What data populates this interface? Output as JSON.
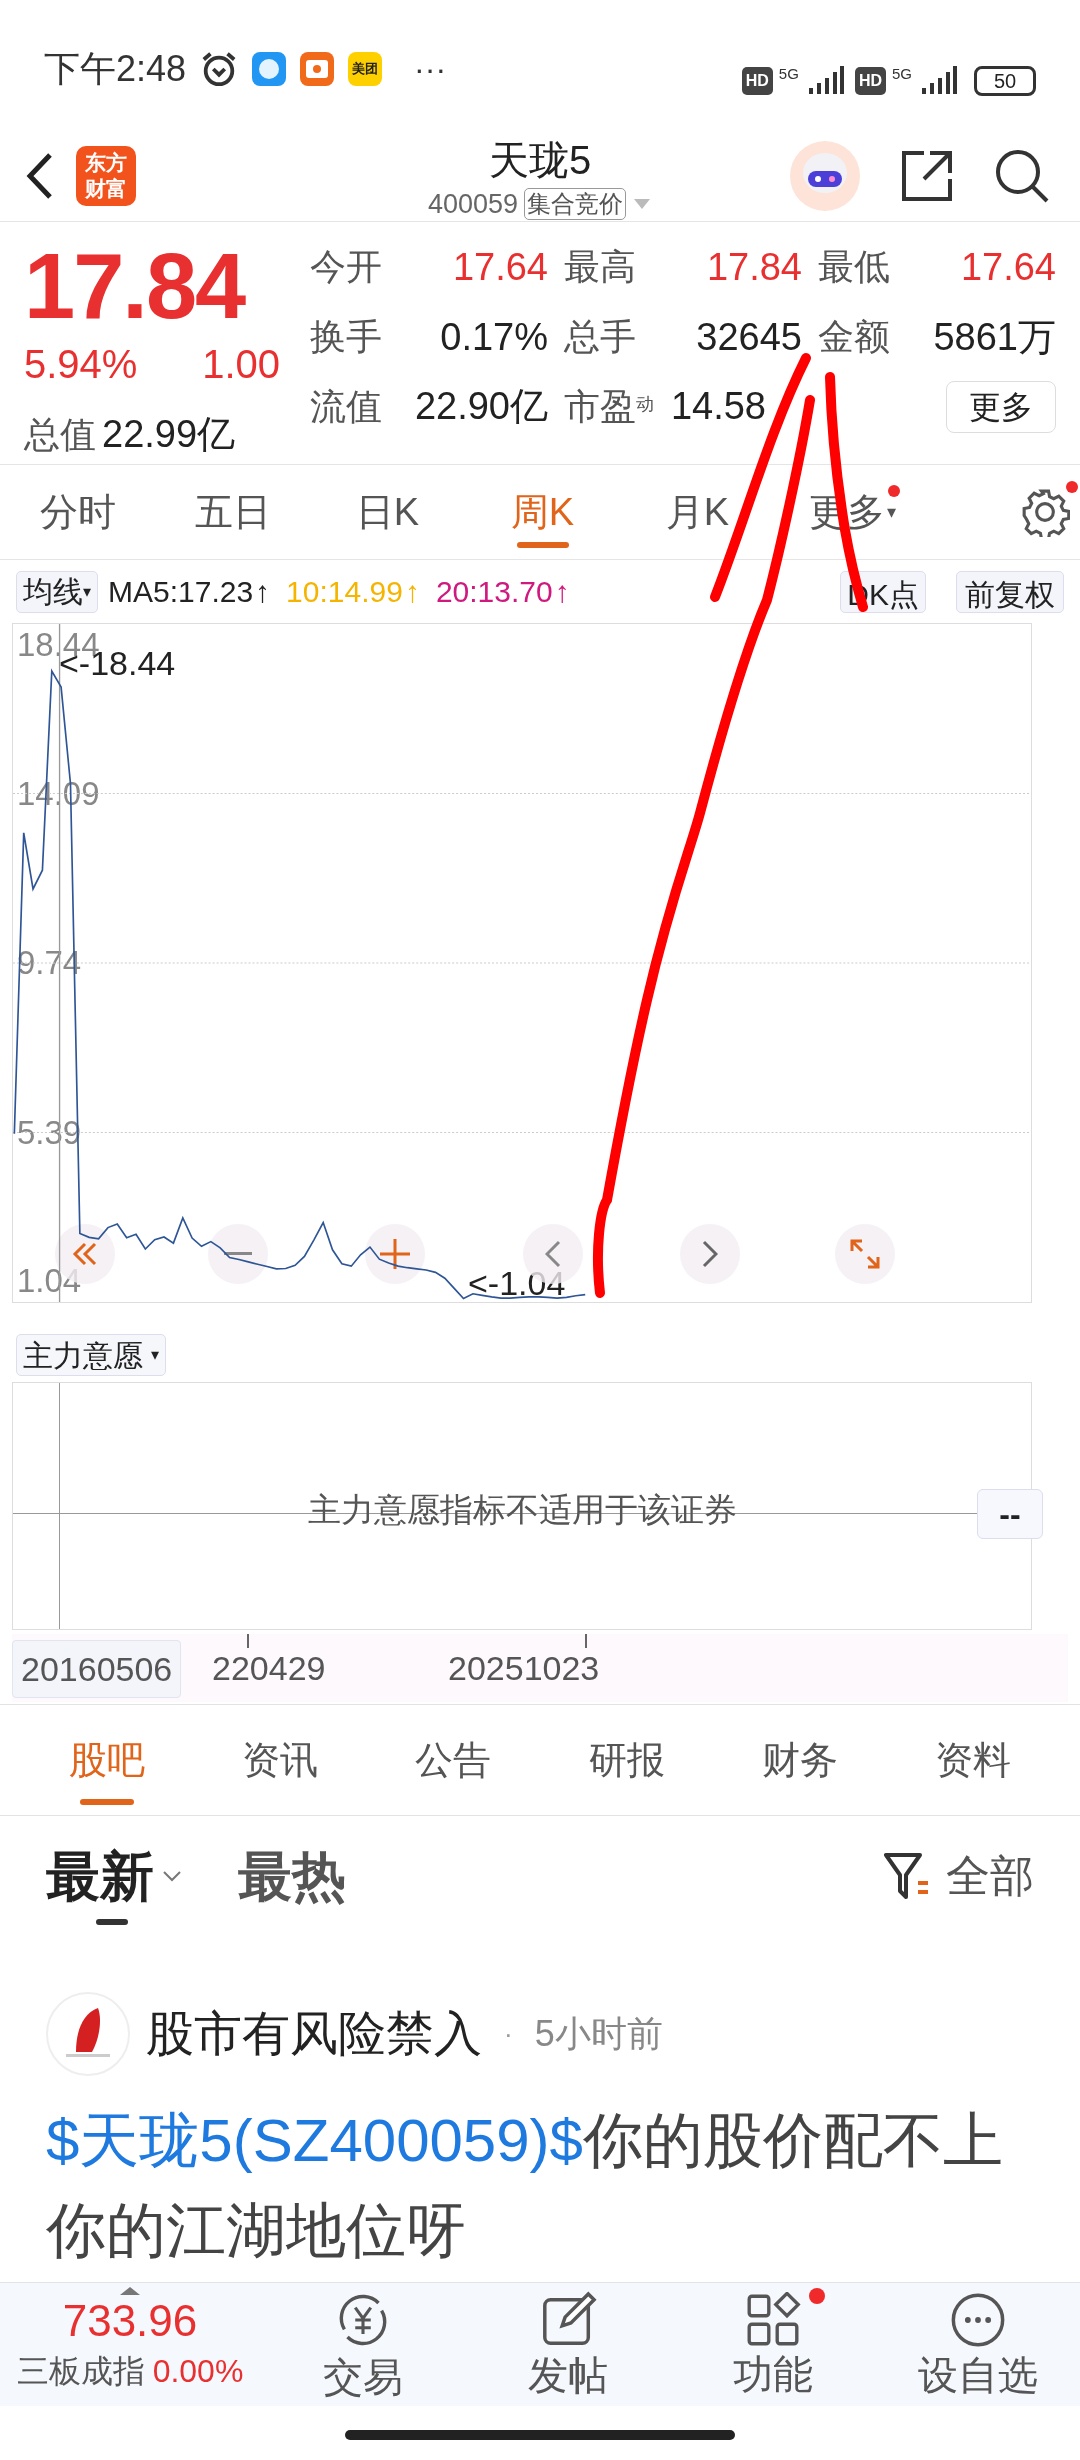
{
  "status_bar": {
    "time": "下午2:48",
    "app_badge": "美团",
    "more": "···",
    "signals": [
      {
        "hd": "HD",
        "net": "5G"
      },
      {
        "hd": "HD",
        "net": "5G"
      }
    ],
    "battery": "50"
  },
  "header": {
    "logo_lines": [
      "东方",
      "财富"
    ],
    "title": "天珑5",
    "code": "400059",
    "market_badge": "集合竞价"
  },
  "quote": {
    "price": "17.84",
    "change_pct": "5.94%",
    "change": "1.00",
    "stats": [
      {
        "label": "今开",
        "value": "17.64",
        "color": "#e93030"
      },
      {
        "label": "最高",
        "value": "17.84",
        "color": "#e93030"
      },
      {
        "label": "最低",
        "value": "17.64",
        "color": "#e93030"
      },
      {
        "label": "换手",
        "value": "0.17%",
        "color": "#222222"
      },
      {
        "label": "总手",
        "value": "32645",
        "color": "#222222"
      },
      {
        "label": "金额",
        "value": "5861万",
        "color": "#222222"
      }
    ],
    "total_value": {
      "label": "总值",
      "value": "22.99亿"
    },
    "float_value": {
      "label": "流值",
      "value": "22.90亿"
    },
    "pe": {
      "label": "市盈$^{动}$",
      "value": "14.58"
    },
    "more_button": "更多"
  },
  "period_tabs": [
    {
      "label": "分时",
      "selected": false,
      "dot": false
    },
    {
      "label": "五日",
      "selected": false,
      "dot": false
    },
    {
      "label": "日K",
      "selected": false,
      "dot": false
    },
    {
      "label": "周K",
      "selected": true,
      "dot": false
    },
    {
      "label": "月K",
      "selected": false,
      "dot": false
    },
    {
      "label": "更多",
      "caret": "▾",
      "selected": false,
      "dot": true
    }
  ],
  "settings_dot": true,
  "ma_bar": {
    "dropdown": "均线",
    "caret": "▾",
    "items": [
      {
        "text": "MA5:17.23",
        "arrow": "↑",
        "color": "#222222"
      },
      {
        "text": "10:14.99",
        "arrow": "↑",
        "color": "#f5b400"
      },
      {
        "text": "20:13.70",
        "arrow": "↑",
        "color": "#d0197f"
      }
    ],
    "dk_button": "DK点",
    "adjust_button": "前复权"
  },
  "chart": {
    "y_labels": [
      "18.44",
      "14.09",
      "9.74",
      "5.39",
      "1.04"
    ],
    "max_marker": "<-18.44",
    "min_marker": "<-1.04",
    "chart_data": {
      "type": "line",
      "grid": true,
      "ylim": [
        1.04,
        18.44
      ],
      "yticks": [
        1.04,
        5.39,
        9.74,
        14.09,
        18.44
      ],
      "series": [
        {
          "color": "#2e5596",
          "values": [
            5.36,
            13.08,
            11.64,
            12.12,
            17.23,
            16.82,
            14.34,
            2.8,
            2.7,
            2.66,
            2.95,
            3.04,
            2.69,
            2.78,
            2.4,
            2.64,
            2.71,
            2.55,
            3.2,
            2.68,
            2.47,
            2.59,
            2.43,
            2.18,
            2.13,
            2.07,
            2.01,
            1.95,
            1.89,
            1.9,
            1.98,
            2.21,
            2.63,
            3.08,
            2.38,
            2.02,
            1.96,
            2.25,
            2.45,
            2.14,
            2.04,
            1.96,
            1.92,
            1.89,
            1.86,
            1.8,
            1.65,
            1.39,
            1.13,
            1.25,
            1.21,
            1.17,
            1.14,
            1.14,
            1.16,
            1.17,
            1.17,
            1.16,
            1.14,
            1.16,
            1.2,
            1.23
          ]
        }
      ]
    }
  },
  "indicator": {
    "dropdown": "主力意愿",
    "caret": "▾",
    "message": "主力意愿指标不适用于该证券",
    "value": "--"
  },
  "x_labels": [
    {
      "text": "20160506",
      "selected": true
    },
    {
      "text": "220429",
      "selected": false
    },
    {
      "text": "20251023",
      "selected": false
    }
  ],
  "info_tabs": [
    {
      "label": "股吧",
      "selected": true
    },
    {
      "label": "资讯",
      "selected": false
    },
    {
      "label": "公告",
      "selected": false
    },
    {
      "label": "研报",
      "selected": false
    },
    {
      "label": "财务",
      "selected": false
    },
    {
      "label": "资料",
      "selected": false
    }
  ],
  "sort_tabs": [
    {
      "label": "最新",
      "selected": true,
      "dropdown": true
    },
    {
      "label": "最热",
      "selected": false,
      "dropdown": false
    }
  ],
  "filter": "全部",
  "post": {
    "author": "股市有风险禁入",
    "separator": "·",
    "time": "5小时前",
    "link": "$天珑5(SZ400059)$",
    "text": "你的股价配不上你的江湖地位呀"
  },
  "bottom_bar": {
    "index_value": "733.96",
    "index_name": "三板成指",
    "index_change": "0.00%",
    "items": [
      {
        "label": "交易",
        "kind": "trade",
        "dot": false
      },
      {
        "label": "发帖",
        "kind": "post",
        "dot": false
      },
      {
        "label": "功能",
        "kind": "apps",
        "dot": true
      },
      {
        "label": "设自选",
        "kind": "more",
        "dot": false
      }
    ]
  }
}
